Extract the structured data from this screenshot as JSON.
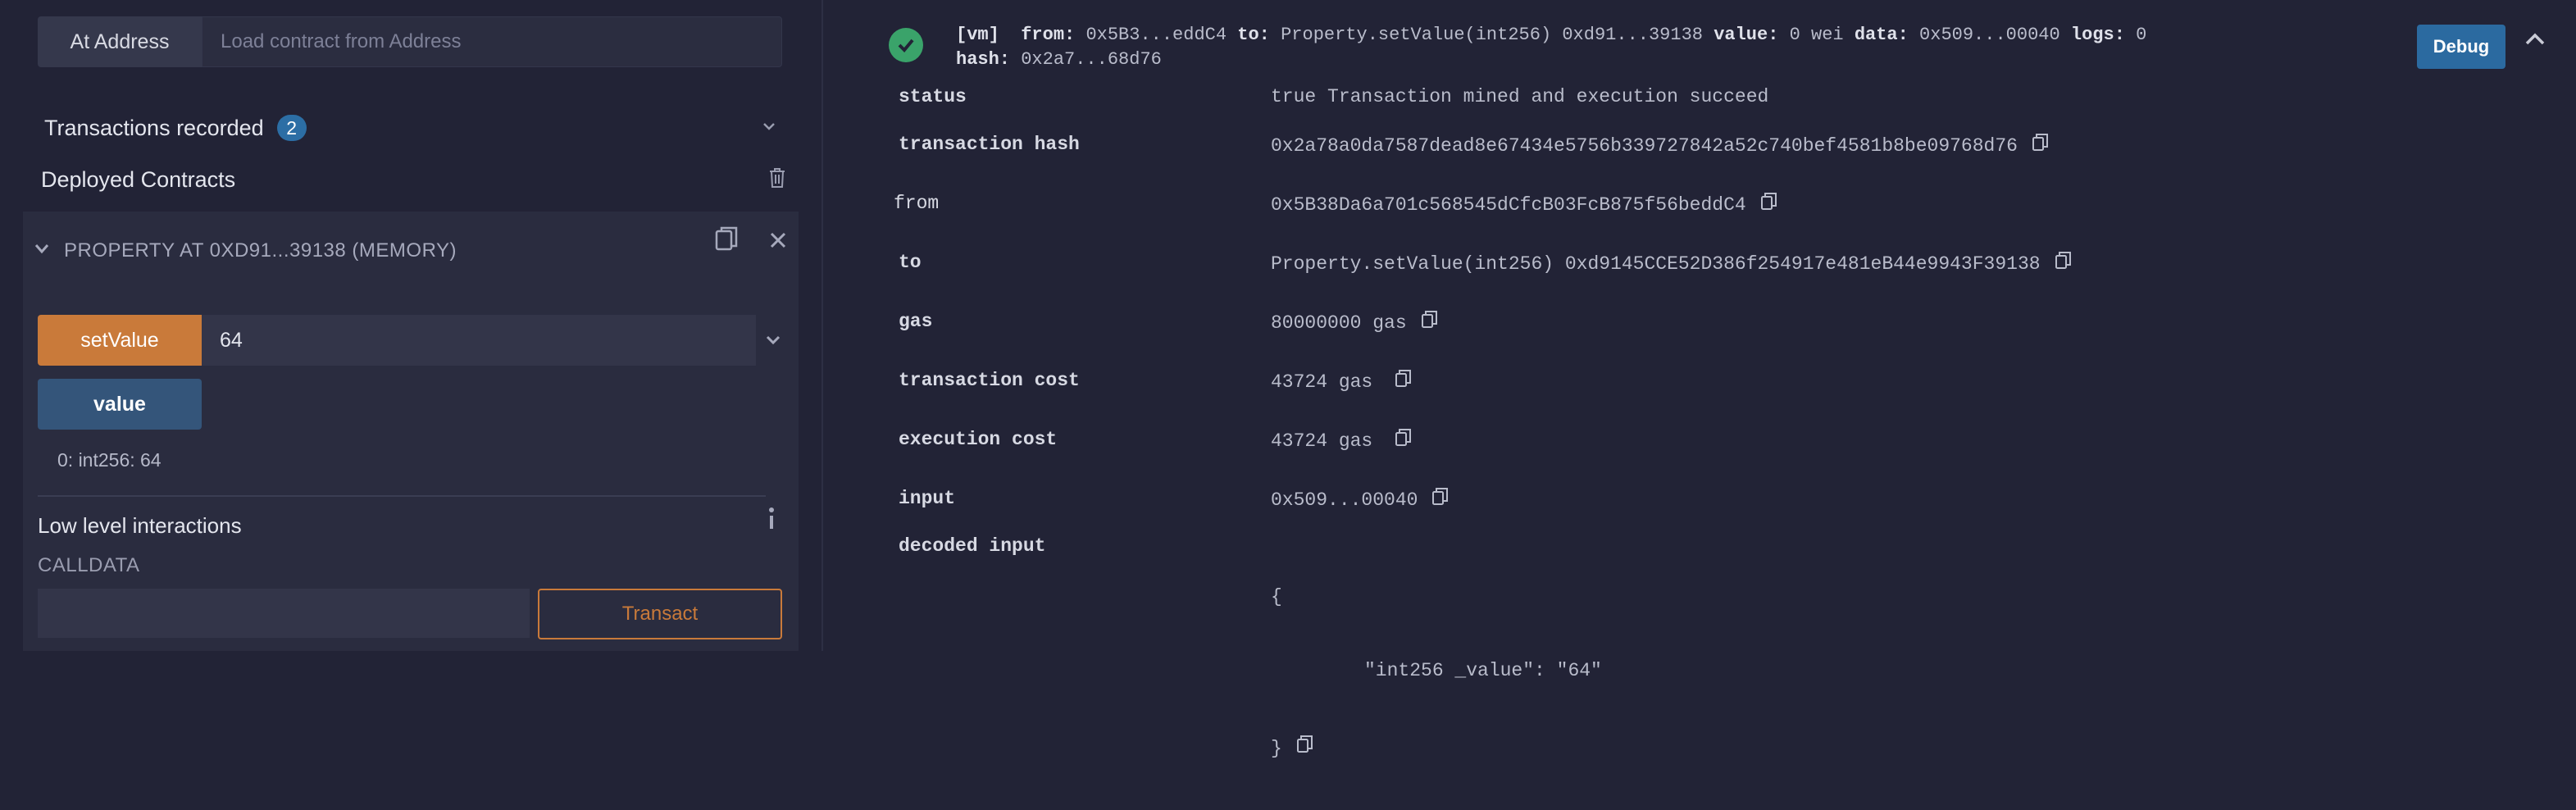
{
  "left": {
    "at_address_label": "At Address",
    "address_placeholder": "Load contract from Address",
    "transactions_recorded_label": "Transactions recorded",
    "transactions_count": "2",
    "deployed_contracts_label": "Deployed Contracts",
    "contract_title": "PROPERTY AT 0XD91...39138 (MEMORY)",
    "set_value_label": "setValue",
    "set_value_input": "64",
    "value_button_label": "value",
    "value_result": "0: int256: 64",
    "low_level_label": "Low level interactions",
    "calldata_label": "CALLDATA",
    "transact_label": "Transact"
  },
  "right": {
    "summary": {
      "vm_tag": "[vm]",
      "from_label": "from:",
      "from_value": "0x5B3...eddC4",
      "to_label": "to:",
      "to_value": "Property.setValue(int256) 0xd91...39138",
      "value_label": "value:",
      "value_value": "0 wei",
      "data_label": "data:",
      "data_value": "0x509...00040",
      "logs_label": "logs:",
      "logs_value": "0",
      "hash_label": "hash:",
      "hash_value": "0x2a7...68d76"
    },
    "debug_label": "Debug",
    "rows": {
      "status": {
        "label": "status",
        "value": "true Transaction mined and execution succeed"
      },
      "tx_hash": {
        "label": "transaction hash",
        "value": "0x2a78a0da7587dead8e67434e5756b339727842a52c740bef4581b8be09768d76"
      },
      "from": {
        "label": "from",
        "value": "0x5B38Da6a701c568545dCfcB03FcB875f56beddC4"
      },
      "to": {
        "label": "to",
        "value": "Property.setValue(int256) 0xd9145CCE52D386f254917e481eB44e9943F39138"
      },
      "gas": {
        "label": "gas",
        "value": "80000000 gas"
      },
      "tx_cost": {
        "label": "transaction cost",
        "value": "43724 gas"
      },
      "exec_cost": {
        "label": "execution cost",
        "value": "43724 gas"
      },
      "input": {
        "label": "input",
        "value": "0x509...00040"
      },
      "decoded_input": {
        "label": "decoded input",
        "open": "{",
        "body": "\"int256 _value\": \"64\"",
        "close": "}"
      }
    }
  },
  "colors": {
    "background": "#222336",
    "panel": "#2a2c3f",
    "accent_orange": "#c97a3a",
    "accent_blue": "#2b6aa0",
    "success_green": "#3aa36a"
  },
  "icons": [
    "chevron-down-icon",
    "trash-icon",
    "copy-icon",
    "close-icon",
    "info-icon",
    "check-circle-icon",
    "chevron-up-icon"
  ]
}
